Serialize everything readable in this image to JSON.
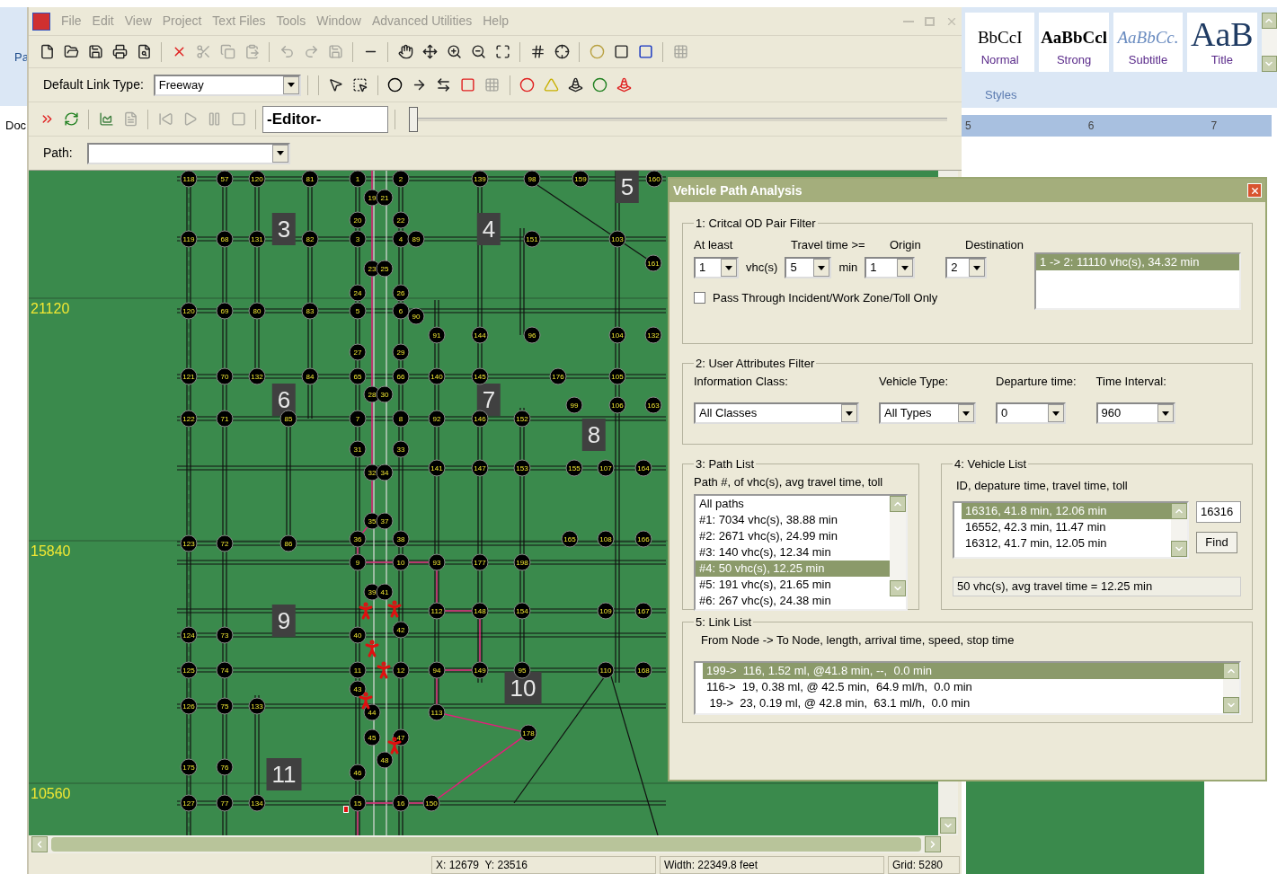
{
  "background_window": {
    "label_1": "Pa",
    "label_2": "Doc"
  },
  "menu": [
    {
      "label": "File"
    },
    {
      "label": "Edit"
    },
    {
      "label": "View"
    },
    {
      "label": "Project"
    },
    {
      "label": "Text Files"
    },
    {
      "label": "Tools"
    },
    {
      "label": "Window"
    },
    {
      "label": "Advanced Utilities"
    },
    {
      "label": "Help"
    }
  ],
  "toolbar": {
    "default_link_type_label": "Default Link Type:",
    "default_link_type": "Freeway",
    "mode": "-Editor-",
    "timeline": {
      "level": 0
    },
    "path_label": "Path:"
  },
  "map": {
    "y_labels": [
      "21120",
      "15840",
      "10560"
    ],
    "zones": [
      "3",
      "4",
      "5",
      "6",
      "7",
      "8",
      "9",
      "10",
      "11"
    ],
    "nodes": [
      "118",
      "57",
      "120",
      "81",
      "1",
      "2",
      "139",
      "98",
      "159",
      "160",
      "19",
      "21",
      "20",
      "22",
      "119",
      "68",
      "131",
      "82",
      "3",
      "4",
      "89",
      "151",
      "103",
      "161",
      "23",
      "25",
      "24",
      "26",
      "120",
      "69",
      "80",
      "83",
      "5",
      "6",
      "90",
      "91",
      "144",
      "96",
      "104",
      "132",
      "27",
      "29",
      "121",
      "70",
      "132",
      "84",
      "65",
      "66",
      "140",
      "145",
      "176",
      "105",
      "28",
      "30",
      "99",
      "106",
      "163",
      "122",
      "71",
      "85",
      "7",
      "8",
      "92",
      "146",
      "152",
      "31",
      "33",
      "32",
      "34",
      "141",
      "147",
      "153",
      "155",
      "107",
      "164",
      "35",
      "37",
      "36",
      "38",
      "165",
      "108",
      "166",
      "123",
      "72",
      "86",
      "9",
      "10",
      "93",
      "177",
      "198",
      "39",
      "41",
      "112",
      "148",
      "154",
      "109",
      "167",
      "42",
      "124",
      "73",
      "40",
      "125",
      "74",
      "11",
      "12",
      "94",
      "149",
      "95",
      "110",
      "168",
      "43",
      "126",
      "75",
      "133",
      "113",
      "44",
      "178",
      "45",
      "47",
      "48",
      "175",
      "76",
      "46",
      "127",
      "77",
      "134",
      "15",
      "16",
      "150"
    ]
  },
  "status_bar": [
    "X: 12679  Y: 23516",
    "Width: 22349.8 feet",
    "Grid: 5280"
  ],
  "word_ribbon": {
    "styles": [
      {
        "kind": "normal",
        "preview": "BbCcI",
        "name": "Normal"
      },
      {
        "kind": "strong",
        "preview": "AaBbCcl",
        "name": "Strong"
      },
      {
        "kind": "subtitle",
        "preview": "AaBbCc.",
        "name": "Subtitle"
      },
      {
        "kind": "title",
        "preview": "AaB",
        "name": "Title"
      }
    ],
    "group_label": "Styles",
    "ruler": [
      "5",
      "6",
      "7"
    ]
  },
  "dialog": {
    "title": "Vehicle Path Analysis",
    "od_filter": {
      "legend": "1: Critcal OD Pair Filter",
      "at_least_label": "At least",
      "at_least": "1",
      "vhc_unit": "vhc(s)",
      "travel_time_label": "Travel time >=",
      "travel_time": "5",
      "min_unit": "min",
      "origin_label": "Origin",
      "origin": "1",
      "destination_label": "Destination",
      "destination": "2",
      "pass_through": {
        "label": "Pass Through Incident/Work Zone/Toll Only",
        "checked": false
      },
      "pairs": [
        {
          "text": "1 -> 2: 11110 vhc(s), 34.32 min",
          "selected": true
        }
      ]
    },
    "user_filter": {
      "legend": "2: User Attributes Filter",
      "fields": [
        {
          "label": "Information Class:",
          "value": "All Classes"
        },
        {
          "label": "Vehicle Type:",
          "value": "All Types"
        },
        {
          "label": "Departure time:",
          "value": "0"
        },
        {
          "label": "Time Interval:",
          "value": "960"
        }
      ]
    },
    "path_list": {
      "legend": "3: Path List",
      "header": "Path #, of vhc(s), avg travel time, toll",
      "items": [
        {
          "text": "All paths",
          "selected": false
        },
        {
          "text": "#1: 7034 vhc(s), 38.88 min",
          "selected": false
        },
        {
          "text": "#2: 2671 vhc(s), 24.99 min",
          "selected": false
        },
        {
          "text": "#3: 140 vhc(s), 12.34 min",
          "selected": false
        },
        {
          "text": "#4: 50 vhc(s), 12.25 min",
          "selected": true
        },
        {
          "text": "#5: 191 vhc(s), 21.65 min",
          "selected": false
        },
        {
          "text": "#6: 267 vhc(s), 24.38 min",
          "selected": false
        }
      ]
    },
    "vehicle_list": {
      "legend": "4: Vehicle List",
      "header": "ID, depature time, travel time, toll",
      "items": [
        {
          "text": "16316, 41.8 min, 12.06 min",
          "selected": true
        },
        {
          "text": "16552, 42.3 min, 11.47 min",
          "selected": false
        },
        {
          "text": "16312, 41.7 min, 12.05 min",
          "selected": false
        }
      ],
      "search_value": "16316",
      "find_button": "Find",
      "summary": "50 vhc(s), avg travel time = 12.25 min"
    },
    "link_list": {
      "legend": "5: Link List",
      "header": "From Node -> To Node, length, arrival time, speed, stop time",
      "items": [
        {
          "text": "199->  116, 1.52 ml, @41.8 min, --,  0.0 min",
          "selected": true
        },
        {
          "text": "116->  19, 0.38 ml, @ 42.5 min,  64.9 ml/h,  0.0 min",
          "selected": false
        },
        {
          "text": " 19->  23, 0.19 ml, @ 42.8 min,  63.1 ml/h,  0.0 min",
          "selected": false
        }
      ]
    }
  }
}
